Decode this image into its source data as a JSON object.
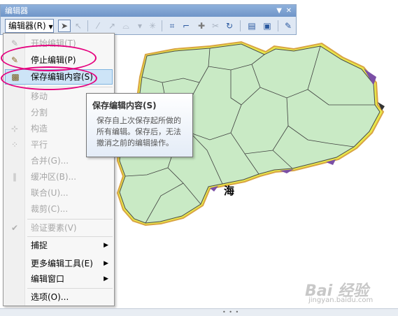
{
  "toolbar": {
    "title": "编辑器",
    "menu_label": "编辑器(R)",
    "tools": [
      "pointer-icon",
      "edit-vertex-icon",
      "straight-segment-icon",
      "end-point-arc-icon",
      "trace-icon",
      "point-icon",
      "edit-vertices-icon",
      "reshape-icon",
      "cut-polygons-icon",
      "split-icon",
      "rotate-icon",
      "attributes-icon",
      "sketch-properties-icon",
      "create-features-icon"
    ]
  },
  "menu": {
    "items": [
      {
        "label": "开始编辑(T)",
        "enabled": false,
        "icon": "pencil-icon"
      },
      {
        "label": "停止编辑(P)",
        "enabled": true,
        "icon": "stop-edit-icon"
      },
      {
        "label": "保存编辑内容(S)",
        "enabled": true,
        "icon": "save-icon"
      },
      {
        "label": "移动",
        "enabled": false
      },
      {
        "label": "分割",
        "enabled": false
      },
      {
        "label": "构造",
        "enabled": false,
        "icon": "construct-icon"
      },
      {
        "label": "平行",
        "enabled": false,
        "icon": "parallel-icon"
      },
      {
        "label": "合并(G)...",
        "enabled": false
      },
      {
        "label": "缓冲区(B)...",
        "enabled": false,
        "icon": "buffer-icon"
      },
      {
        "label": "联合(U)...",
        "enabled": false
      },
      {
        "label": "裁剪(C)...",
        "enabled": false
      },
      {
        "label": "验证要素(V)",
        "enabled": false,
        "icon": "validate-icon"
      },
      {
        "label": "捕捉",
        "enabled": true,
        "submenu": true
      },
      {
        "label": "更多编辑工具(E)",
        "enabled": true,
        "submenu": true
      },
      {
        "label": "编辑窗口",
        "enabled": true,
        "submenu": true
      },
      {
        "label": "选项(O)...",
        "enabled": true
      }
    ]
  },
  "tooltip": {
    "title": "保存编辑内容(S)",
    "body": "保存自上次保存起所做的所有编辑。保存后，无法撤消之前的编辑操作。"
  },
  "map": {
    "label": "海",
    "fill_color": "#c9eac5",
    "border_color": "#e8a04a",
    "accent_purple": "#7b4fa6",
    "accent_yellow": "#e8e84a"
  },
  "watermark": {
    "brand": "Bai 经验",
    "url": "jingyan.baidu.com"
  },
  "colors": {
    "annotation": "#e5007e",
    "highlight": "#cde4f7"
  }
}
